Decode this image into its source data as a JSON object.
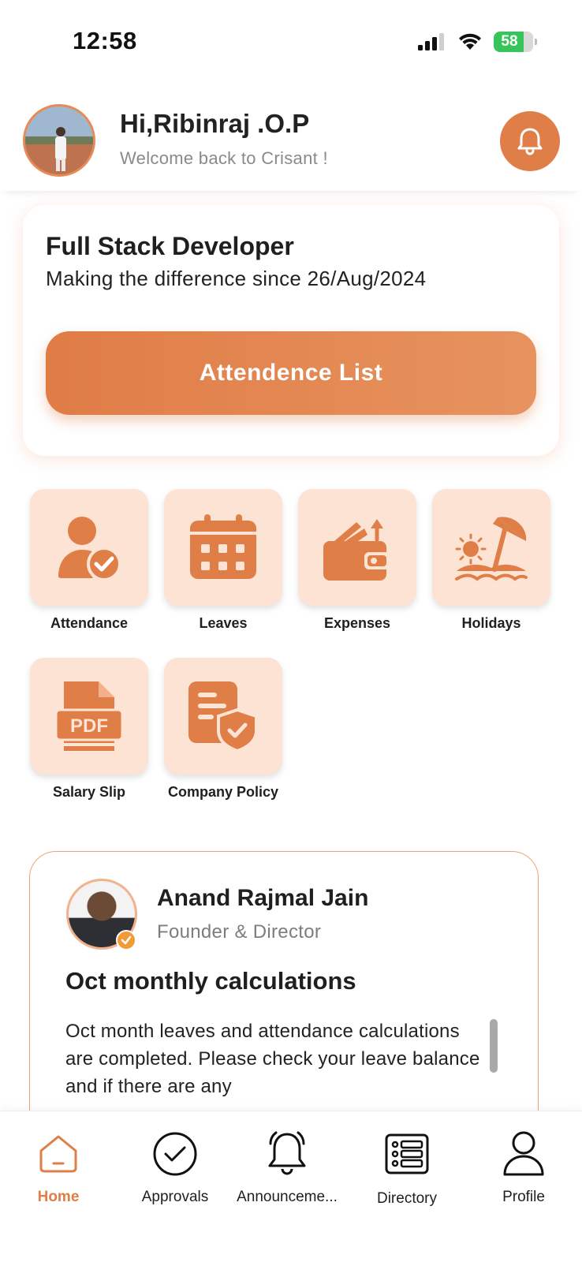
{
  "status_bar": {
    "time": "12:58",
    "battery": "58"
  },
  "header": {
    "greeting": "Hi,Ribinraj .O.P",
    "subtitle": "Welcome back to Crisant !"
  },
  "role_card": {
    "title": "Full Stack Developer",
    "subtitle": "Making the difference since 26/Aug/2024",
    "button_label": "Attendence List"
  },
  "tiles": [
    {
      "label": "Attendance",
      "icon": "user-check-icon"
    },
    {
      "label": "Leaves",
      "icon": "calendar-icon"
    },
    {
      "label": "Expenses",
      "icon": "wallet-icon"
    },
    {
      "label": "Holidays",
      "icon": "beach-umbrella-icon"
    },
    {
      "label": "Salary Slip",
      "icon": "pdf-file-icon"
    },
    {
      "label": "Company Policy",
      "icon": "policy-shield-icon"
    }
  ],
  "announcement": {
    "author_name": "Anand Rajmal Jain",
    "author_role": "Founder & Director",
    "title": "Oct monthly calculations",
    "body": "Oct month leaves and attendance calculations are completed. Please check your leave balance and if there are any"
  },
  "bottom_nav": [
    {
      "label": "Home",
      "icon": "home-icon",
      "active": true
    },
    {
      "label": "Approvals",
      "icon": "check-circle-icon",
      "active": false
    },
    {
      "label": "Announceme...",
      "icon": "bell-outline-icon",
      "active": false
    },
    {
      "label": "Directory",
      "icon": "directory-list-icon",
      "active": false
    },
    {
      "label": "Profile",
      "icon": "person-icon",
      "active": false
    }
  ],
  "colors": {
    "accent": "#e07e48",
    "tile_bg": "#fde3d4",
    "battery": "#37c45a"
  }
}
